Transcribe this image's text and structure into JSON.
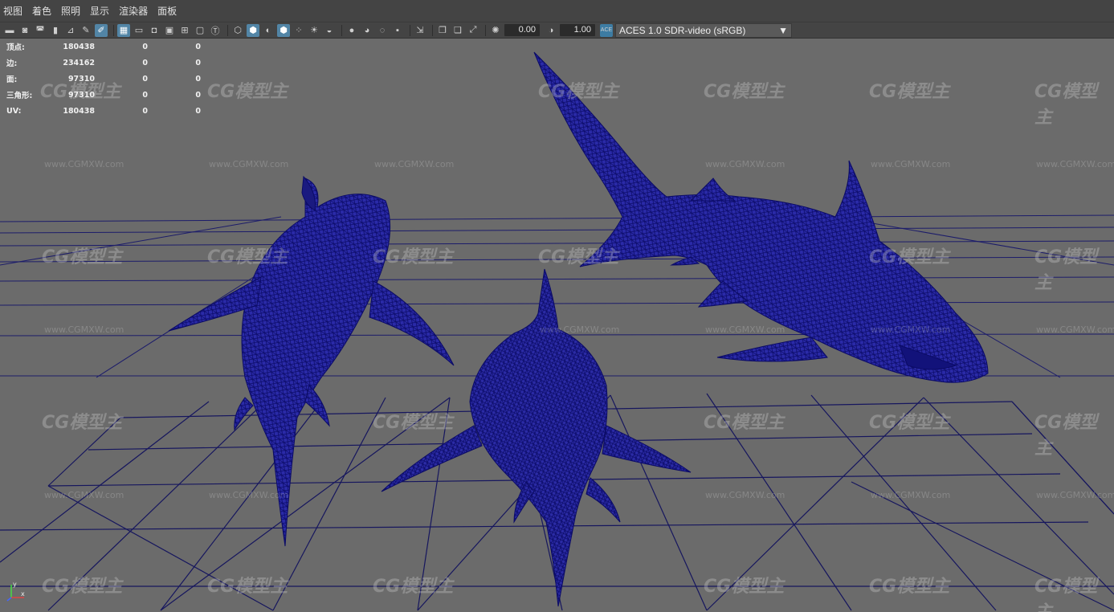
{
  "menu": {
    "items": [
      "视图",
      "着色",
      "照明",
      "显示",
      "渲染器",
      "面板"
    ]
  },
  "toolbar": {
    "exposure_value": "0.00",
    "gamma_value": "1.00",
    "color_space": "ACES 1.0 SDR-video (sRGB)",
    "color_space_icon": "aces-icon",
    "active_color": "#5285a6"
  },
  "hud": {
    "rows": [
      {
        "label": "顶点:",
        "v1": "180438",
        "v2": "0",
        "v3": "0"
      },
      {
        "label": "边:",
        "v1": "234162",
        "v2": "0",
        "v3": "0"
      },
      {
        "label": "面:",
        "v1": "97310",
        "v2": "0",
        "v3": "0"
      },
      {
        "label": "三角形:",
        "v1": "97310",
        "v2": "0",
        "v3": "0"
      },
      {
        "label": "UV:",
        "v1": "180438",
        "v2": "0",
        "v3": "0"
      }
    ]
  },
  "viewport": {
    "background_color": "#6b6b6b",
    "wire_color": "#1a1a8c",
    "grid_color": "#1c1c6a"
  },
  "watermark": {
    "logo_text": "CG模型主",
    "url_text": "www.CGMXW.com"
  },
  "axis": {
    "y_label": "y",
    "x_label": "x"
  }
}
